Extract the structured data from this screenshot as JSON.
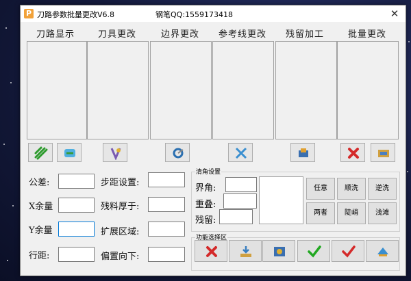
{
  "window": {
    "title": "刀路参数批量更改V6.8",
    "author": "钢笔QQ:1559173418",
    "close": "✕",
    "app_icon": "P"
  },
  "columns": [
    "刀路显示",
    "刀具更改",
    "边界更改",
    "参考线更改",
    "残留加工",
    "批量更改"
  ],
  "params": {
    "tolerance": "公差:",
    "x_stock": "X余量",
    "y_stock": "Y余量",
    "row_spacing": "行距:",
    "stepdown": "步距设置:",
    "residual_thickness": "残料厚于:",
    "expand_area": "扩展区域:",
    "offset_down": "偏置向下:"
  },
  "corner": {
    "group_title": "清角设置",
    "boundary_angle": "界角:",
    "overlap": "重叠:",
    "residual": "残留:",
    "buttons": [
      "任意",
      "顺洗",
      "逆洗",
      "两者",
      "陡峭",
      "浅滩"
    ]
  },
  "function_group": {
    "title": "功能选择区"
  }
}
